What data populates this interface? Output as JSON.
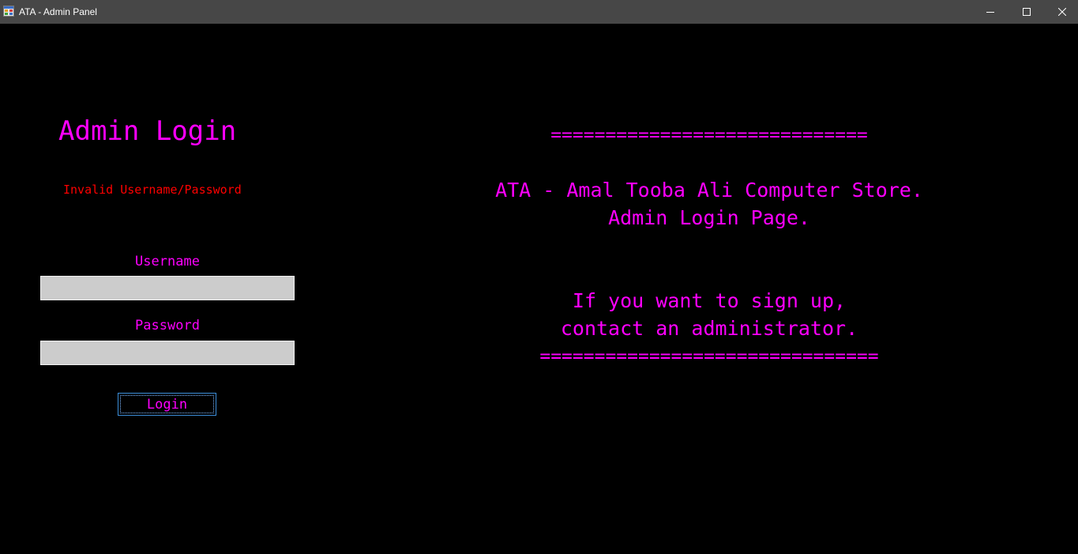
{
  "window": {
    "title": "ATA - Admin Panel",
    "icon": "app-window-icon",
    "controls": [
      "minimize-icon",
      "maximize-icon",
      "close-icon"
    ]
  },
  "login_panel": {
    "title": "Admin Login",
    "error_message": "Invalid Username/Password",
    "username_label": "Username",
    "username_value": "",
    "password_label": "Password",
    "password_value": "",
    "login_button_label": "Login"
  },
  "info_panel": {
    "separator_top": "=============================",
    "store_line": "ATA - Amal Tooba Ali Computer Store.",
    "page_line": "Admin Login Page.",
    "signup_line": "If you want to sign up,",
    "contact_line": "contact an administrator.",
    "separator_bottom": "==============================="
  },
  "colors": {
    "background": "#000000",
    "accent": "#ff00ff",
    "error": "#ff0000",
    "input_background": "#cccccc",
    "titlebar": "#474747",
    "focus_border": "#3c8fdb"
  }
}
